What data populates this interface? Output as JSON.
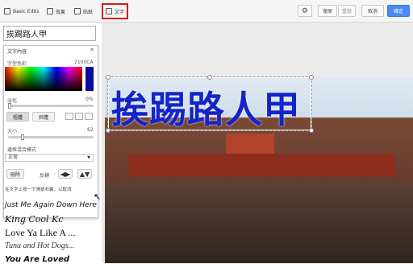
{
  "toolbar": {
    "tabs": [
      {
        "label": "Basic Edits",
        "icon": "adjust-icon"
      },
      {
        "label": "效果",
        "icon": "effects-icon"
      },
      {
        "label": "貼紙",
        "icon": "sticker-icon"
      },
      {
        "label": "文字",
        "icon": "text-icon"
      }
    ],
    "undo_label": "復原",
    "redo_label": "重做",
    "cancel_label": "取消",
    "done_label": "確定"
  },
  "text_panel": {
    "text_value": "挨踢路人甲",
    "title": "文字內容",
    "color_label": "字型色彩",
    "color_hex": "2100CA",
    "fade_label": "淡化",
    "fade_value": "0%",
    "bold_label": "粗體",
    "italic_label": "斜體",
    "size_label": "大小",
    "size_value": "62",
    "blend_label": "邊框混合模式",
    "blend_value": "正常",
    "delete_label": "刪除",
    "flip_label": "反轉",
    "hint": "在文字上按一下滑鼠右鍵，以取消",
    "fade_level": 0.0,
    "size_level": 0.16
  },
  "fonts": [
    "Just Me Again Down Here",
    "King Cool Kc",
    "Love Ya Like A ...",
    "Tuna and Hot Dogs...",
    "You Are Loved"
  ],
  "canvas": {
    "overlay_text": "挨踢路人甲",
    "overlay_color": "#1424c8"
  }
}
